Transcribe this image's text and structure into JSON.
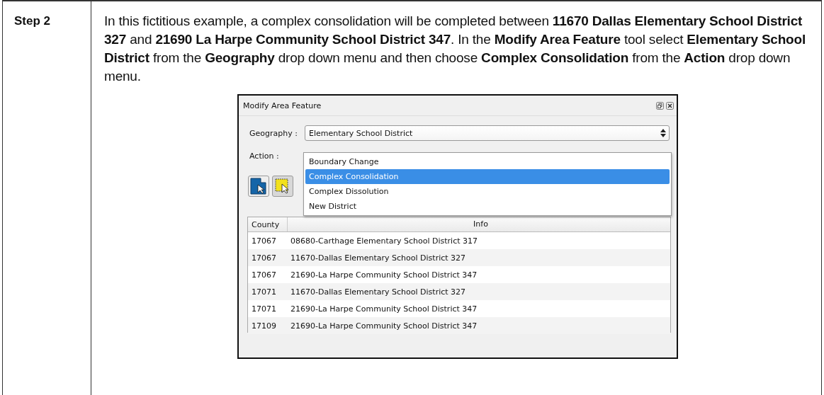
{
  "step": {
    "label": "Step 2",
    "text": "In this fictitious example, a complex consolidation will be completed between **11670 Dallas Elementary School District 327** and **21690 La Harpe Community School District 347**. In the **Modify Area Feature** tool select **Elementary School District** from the **Geography** drop down menu and then choose **Complex Consolidation** from the **Action** drop down menu."
  },
  "dialog": {
    "title": "Modify Area Feature",
    "geography": {
      "label": "Geography :",
      "value": "Elementary School District"
    },
    "action": {
      "label": "Action :",
      "options": [
        {
          "label": "Boundary Change",
          "selected": false
        },
        {
          "label": "Complex Consolidation",
          "selected": true
        },
        {
          "label": "Complex Dissolution",
          "selected": false
        },
        {
          "label": "New District",
          "selected": false
        }
      ]
    },
    "table": {
      "columns": [
        "County",
        "Info"
      ],
      "rows": [
        [
          "17067",
          "08680-Carthage Elementary School District 317"
        ],
        [
          "17067",
          "11670-Dallas Elementary School District 327"
        ],
        [
          "17067",
          "21690-La Harpe Community School District 347"
        ],
        [
          "17071",
          "11670-Dallas Elementary School District 327"
        ],
        [
          "17071",
          "21690-La Harpe Community School District 347"
        ],
        [
          "17109",
          "21690-La Harpe Community School District 347"
        ]
      ]
    }
  }
}
